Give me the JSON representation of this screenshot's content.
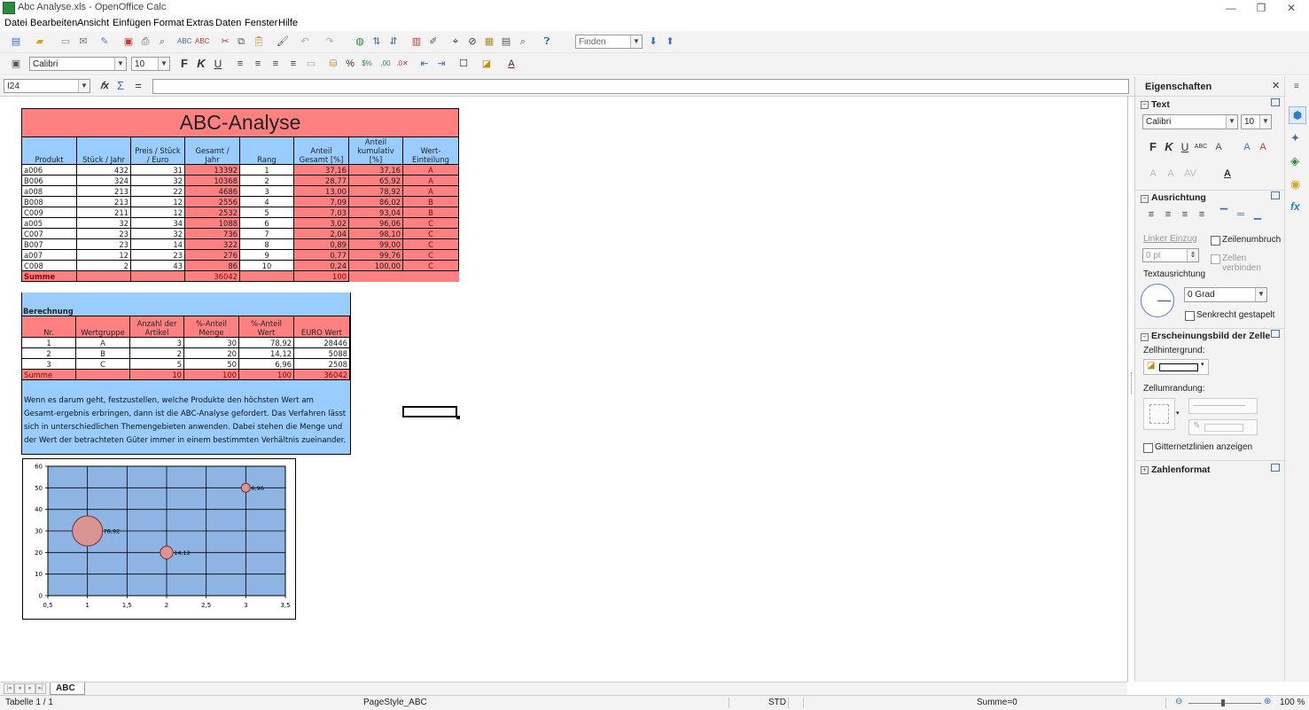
{
  "window": {
    "title": "Abc Analyse.xls - OpenOffice Calc",
    "min": "—",
    "max": "❐",
    "close": "✕"
  },
  "menu": [
    "Datei",
    "Bearbeiten",
    "Ansicht",
    "Einfügen",
    "Format",
    "Extras",
    "Daten",
    "Fenster",
    "Hilfe"
  ],
  "toolbar": {
    "find_placeholder": "Finden",
    "font_name": "Calibri",
    "font_size": "10",
    "bold": "F",
    "italic": "K",
    "underline": "U"
  },
  "formula": {
    "cell_ref": "I24",
    "fx": "𝑓x",
    "sum": "Σ",
    "eq": "=",
    "value": ""
  },
  "sheet": {
    "title": "ABC-Analyse",
    "headers": [
      "Produkt",
      "Stück / Jahr",
      "Preis / Stück / Euro",
      "Gesamt / Jahr",
      "Rang",
      "Anteil Gesamt [%]",
      "Anteil kumulativ [%]",
      "Wert-Einteilung"
    ],
    "rows": [
      [
        "a006",
        "432",
        "31",
        "13392",
        "1",
        "37,16",
        "37,16",
        "A"
      ],
      [
        "B006",
        "324",
        "32",
        "10368",
        "2",
        "28,77",
        "65,92",
        "A"
      ],
      [
        "a008",
        "213",
        "22",
        "4686",
        "3",
        "13,00",
        "78,92",
        "A"
      ],
      [
        "B008",
        "213",
        "12",
        "2556",
        "4",
        "7,09",
        "86,02",
        "B"
      ],
      [
        "C009",
        "211",
        "12",
        "2532",
        "5",
        "7,03",
        "93,04",
        "B"
      ],
      [
        "a005",
        "32",
        "34",
        "1088",
        "6",
        "3,02",
        "96,06",
        "C"
      ],
      [
        "C007",
        "23",
        "32",
        "736",
        "7",
        "2,04",
        "98,10",
        "C"
      ],
      [
        "B007",
        "23",
        "14",
        "322",
        "8",
        "0,89",
        "99,00",
        "C"
      ],
      [
        "a007",
        "12",
        "23",
        "276",
        "9",
        "0,77",
        "99,76",
        "C"
      ],
      [
        "C008",
        "2",
        "43",
        "86",
        "10",
        "0,24",
        "100,00",
        "C"
      ]
    ],
    "sum_row": [
      "Summe",
      "",
      "",
      "36042",
      "",
      "100",
      "",
      ""
    ],
    "calc_title": "Berechnung",
    "calc_headers": [
      "Nr.",
      "Wertgruppe",
      "Anzahl der Artikel",
      "%-Anteil Menge",
      "%-Anteil Wert",
      "EURO Wert"
    ],
    "calc_rows": [
      [
        "1",
        "A",
        "3",
        "30",
        "78,92",
        "28446"
      ],
      [
        "2",
        "B",
        "2",
        "20",
        "14,12",
        "5088"
      ],
      [
        "3",
        "C",
        "5",
        "50",
        "6,96",
        "2508"
      ]
    ],
    "calc_sum": [
      "Summe",
      "",
      "10",
      "100",
      "100",
      "36042"
    ],
    "description": "Wenn es darum geht, festzustellen, welche Produkte den höchsten Wert am Gesamt-ergebnis erbringen, dann ist die ABC-Analyse gefordert. Das Verfahren lässt sich in unterschiedlichen Themengebieten anwenden. Dabei stehen die Menge und der Wert der betrachteten Güter immer in einem bestimmten Verhältnis zueinander."
  },
  "chart_data": {
    "type": "scatter",
    "title": "",
    "xlabel": "",
    "ylabel": "",
    "xlim": [
      0.5,
      3.5
    ],
    "ylim": [
      0,
      60
    ],
    "x_ticks": [
      "0,5",
      "1",
      "1,5",
      "2",
      "2,5",
      "3",
      "3,5"
    ],
    "y_ticks": [
      "0",
      "10",
      "20",
      "30",
      "40",
      "50",
      "60"
    ],
    "points": [
      {
        "x": 1,
        "y": 30,
        "size": 78.92,
        "label": "78,92"
      },
      {
        "x": 2,
        "y": 20,
        "size": 14.12,
        "label": "14,12"
      },
      {
        "x": 3,
        "y": 50,
        "size": 6.96,
        "label": "6,96"
      }
    ],
    "grid": true,
    "colors": {
      "plot": "#8db4e2",
      "bubble": "#d99594"
    }
  },
  "sidebar": {
    "title": "Eigenschaften",
    "text_section": "Text",
    "font_name": "Calibri",
    "font_size": "10",
    "align_section": "Ausrichtung",
    "indent_label": "Linker Einzug",
    "indent_value": "0 pt",
    "wrap_label": "Zeilenumbruch",
    "merge_label": "Zellen verbinden",
    "orient_label": "Textausrichtung",
    "angle_value": "0 Grad",
    "stacked_label": "Senkrecht gestapelt",
    "appearance_section": "Erscheinungsbild der Zelle",
    "bg_label": "Zellhintergrund:",
    "border_label": "Zellumrandung:",
    "gridlines_label": "Gitternetzlinien anzeigen",
    "number_section": "Zahlenformat"
  },
  "tabs": {
    "sheet_tab": "ABC"
  },
  "status": {
    "sheet": "Tabelle 1 / 1",
    "style": "PageStyle_ABC",
    "mode": "STD",
    "sum": "Summe=0",
    "zoom": "100 %"
  }
}
